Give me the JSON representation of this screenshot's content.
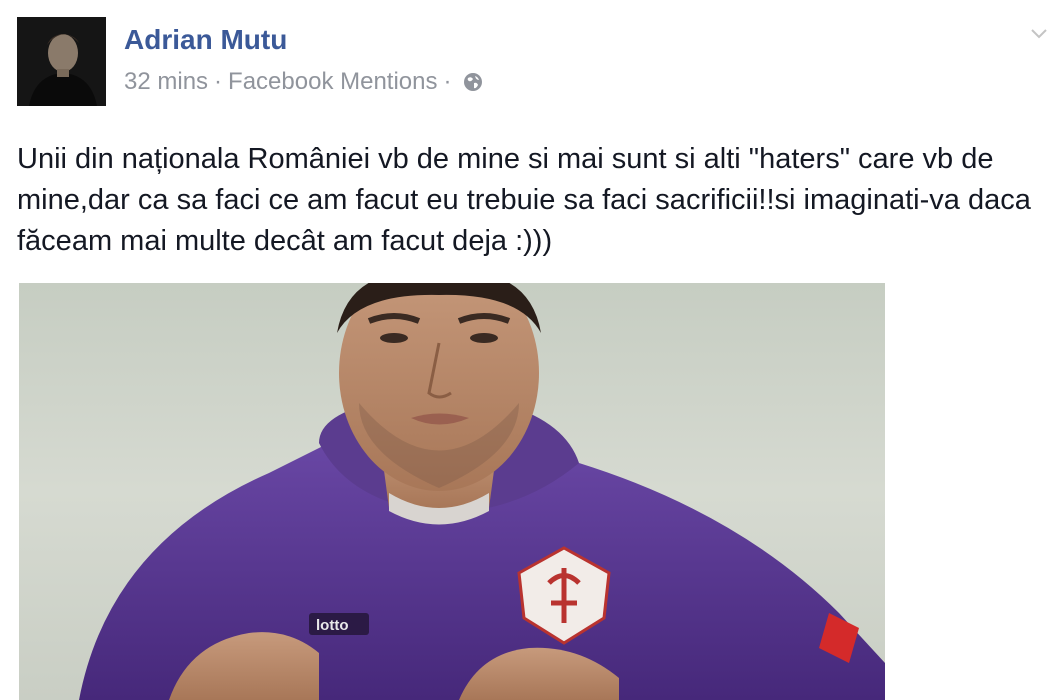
{
  "post": {
    "author": "Adrian Mutu",
    "time": "32 mins",
    "source": "Facebook Mentions",
    "separator": "·",
    "text": "Unii din naționala României vb de mine si mai sunt si alti \"haters\" care vb de mine,dar ca sa faci ce am facut eu trebuie sa faci sacrificii!!si imaginati-va daca făceam mai multe decât am facut deja :)))",
    "privacy_icon": "globe-icon",
    "options_icon": "chevron-down-icon"
  },
  "photo": {
    "jersey_brand": "lotto",
    "colors": {
      "jersey": "#5b3c8f",
      "background": "#cfd4ca"
    }
  },
  "colors": {
    "name": "#3b5998",
    "meta": "#90949c",
    "text": "#141823"
  }
}
